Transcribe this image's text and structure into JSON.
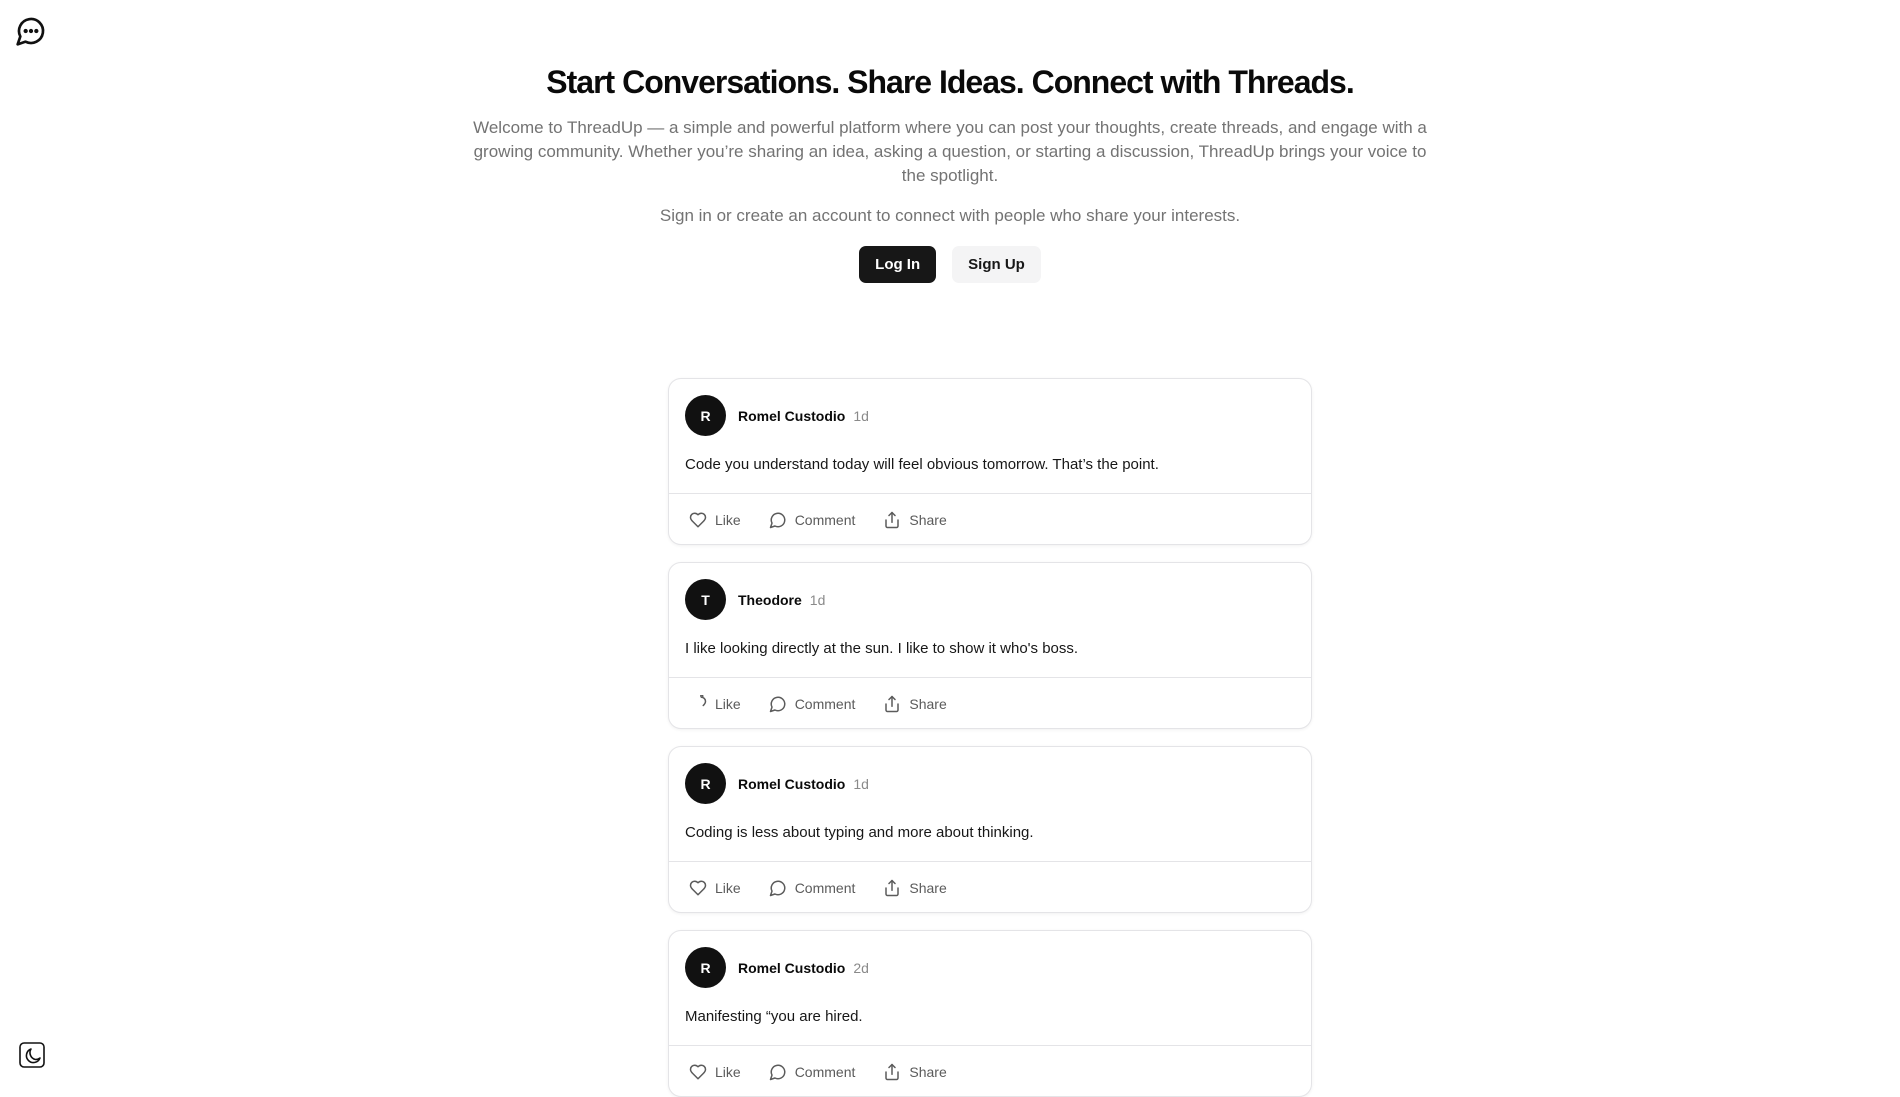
{
  "app": {
    "logo_icon": "message-circle-more-icon",
    "theme_icon": "moon-icon"
  },
  "hero": {
    "title": "Start Conversations. Share Ideas. Connect with Threads.",
    "intro": "Welcome to ThreadUp — a simple and powerful platform where you can post your thoughts, create threads, and engage with a growing community. Whether you’re sharing an idea, asking a question, or starting a discussion, ThreadUp brings your voice to the spotlight.",
    "cta_text": "Sign in or create an account to connect with people who share your interests.",
    "login_label": "Log In",
    "signup_label": "Sign Up"
  },
  "actions": {
    "like": "Like",
    "comment": "Comment",
    "share": "Share"
  },
  "posts": [
    {
      "initial": "R",
      "author": "Romel Custodio",
      "time": "1d",
      "content": "Code you understand today will feel obvious tomorrow. That’s the point."
    },
    {
      "initial": "T",
      "author": "Theodore",
      "time": "1d",
      "content": "I like looking directly at the sun. I like to show it who's boss."
    },
    {
      "initial": "R",
      "author": "Romel Custodio",
      "time": "1d",
      "content": "Coding is less about typing and more about thinking."
    },
    {
      "initial": "R",
      "author": "Romel Custodio",
      "time": "2d",
      "content": "Manifesting “you are hired."
    }
  ],
  "colors": {
    "primary": "#171717",
    "muted_text": "#737373",
    "border": "#e4e4e7"
  }
}
